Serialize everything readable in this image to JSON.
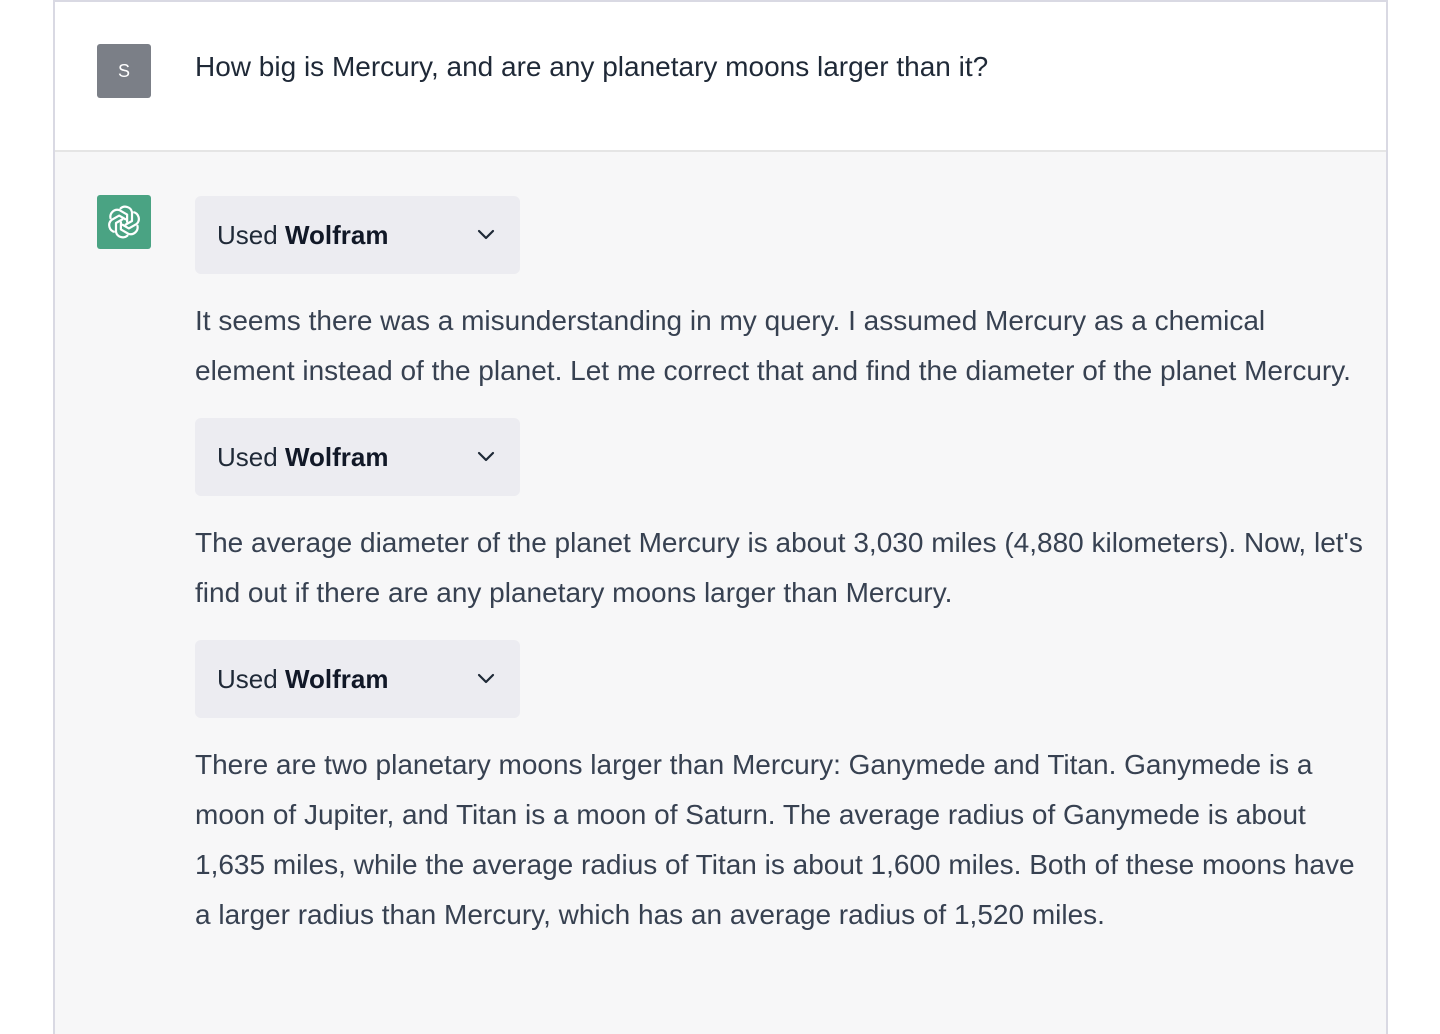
{
  "user": {
    "avatar_letter": "S",
    "message": "How big is Mercury, and are any planetary moons larger than it?"
  },
  "assistant": {
    "avatar_icon": "openai-logo-icon",
    "tool_prefix": "Used",
    "tool_name": "Wolfram",
    "chevron_icon": "chevron-down-icon",
    "paragraphs": [
      "It seems there was a misunderstanding in my query. I assumed Mercury as a chemical element instead of the planet. Let me correct that and find the diameter of the planet Mercury.",
      "The average diameter of the planet Mercury is about 3,030 miles (4,880 kilometers). Now, let's find out if there are any planetary moons larger than Mercury.",
      "There are two planetary moons larger than Mercury: Ganymede and Titan. Ganymede is a moon of Jupiter, and Titan is a moon of Saturn. The average radius of Ganymede is about 1,635 miles, while the average radius of Titan is about 1,600 miles. Both of these moons have a larger radius than Mercury, which has an average radius of 1,520 miles."
    ]
  },
  "colors": {
    "user_avatar": "#7b7f87",
    "assistant_avatar": "#4aa383",
    "assistant_bg": "#f7f7f8",
    "tool_bg": "#ececf1"
  }
}
